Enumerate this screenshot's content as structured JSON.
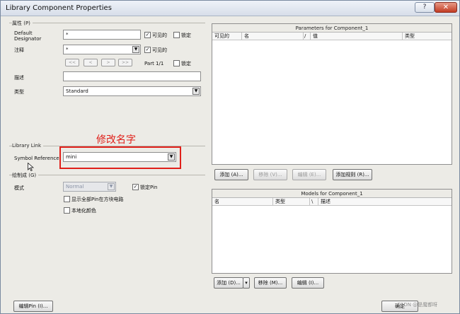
{
  "window": {
    "title": "Library Component Properties",
    "help_glyph": "?",
    "close_glyph": "✕"
  },
  "properties": {
    "group_title": "属性 (P)",
    "designator_label": "Default\nDesignator",
    "designator_value": "*",
    "visible_label": "可见的",
    "locked_label": "锁定",
    "comment_label": "注释",
    "comment_value": "*",
    "comment_visible_label": "可见的",
    "nav_first": "<<",
    "nav_prev": "<",
    "nav_next": ">",
    "nav_last": ">>",
    "part_label": "Part 1/1",
    "part_locked_label": "锁定",
    "description_label": "描述",
    "description_value": "",
    "type_label": "类型",
    "type_value": "Standard"
  },
  "library_link": {
    "group_title": "Library Link",
    "symbol_reference_label": "Symbol Reference",
    "symbol_reference_value": "mini"
  },
  "graphical": {
    "group_title": "绘制成 (G)",
    "mode_label": "模式",
    "mode_value": "Normal",
    "lock_pins_label": "锁定Pin",
    "show_hidden_pins_label": "显示全部Pin在方块电路",
    "local_colors_label": "本地化颜色"
  },
  "annotation": {
    "text": "修改名字"
  },
  "parameters": {
    "title": "Parameters for Component_1",
    "columns": [
      "可见的",
      "名",
      "/",
      "值",
      "类型"
    ],
    "buttons": {
      "add": "添加 (A)...",
      "remove": "移除 (V)...",
      "edit": "编辑 (E)...",
      "add_as_rule": "添加规则 (R)..."
    }
  },
  "models": {
    "title": "Models for Component_1",
    "columns": [
      "名",
      "类型",
      "\\",
      "描述"
    ],
    "buttons": {
      "add": "添加 (D)...",
      "remove": "移除 (M)...",
      "edit": "编辑 (I)..."
    }
  },
  "footer": {
    "edit_pins": "编辑Pin (I)...",
    "ok": "确定"
  },
  "watermark": "CSDN @是魔都呀",
  "colors": {
    "annotation_red": "#e0201a",
    "dialog_bg": "#ecebe6",
    "close_red": "#c23b22"
  },
  "icons": {
    "help": "help-icon",
    "close": "close-icon",
    "dropdown": "chevron-down-icon",
    "cursor": "mouse-cursor-icon",
    "checkbox": "checkbox-check-icon"
  }
}
